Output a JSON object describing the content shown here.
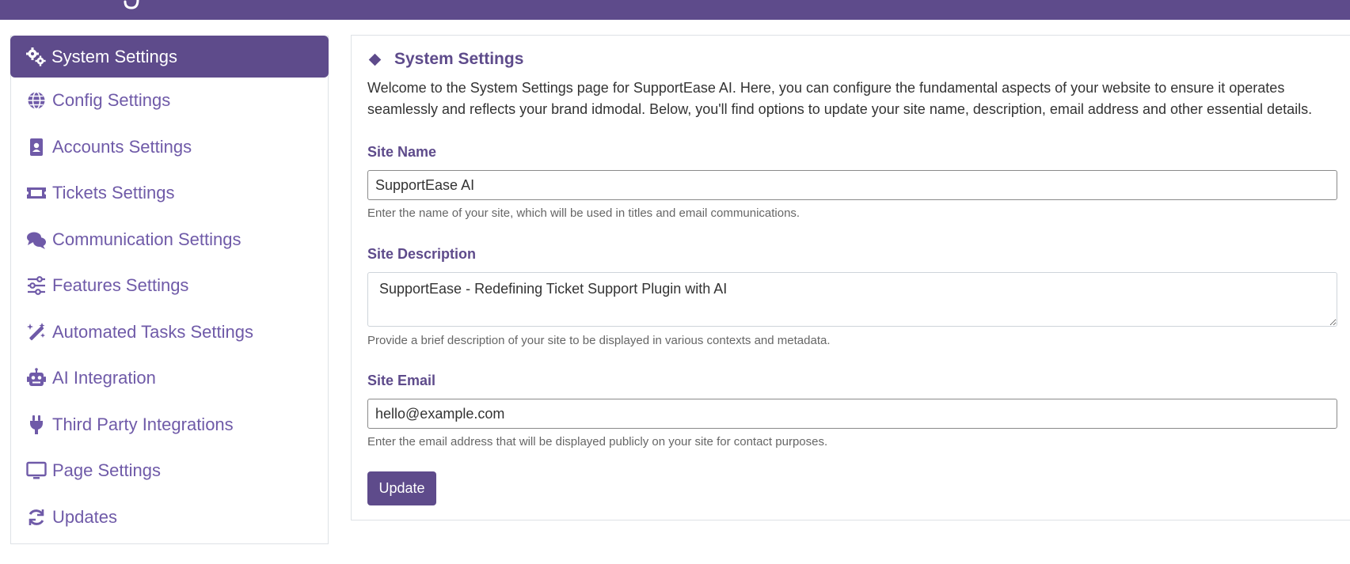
{
  "colors": {
    "brand": "#5e4b8b",
    "link": "#6f5aa8"
  },
  "sidebar": {
    "items": [
      {
        "label": "System Settings",
        "icon": "gears-icon",
        "active": true
      },
      {
        "label": "Config Settings",
        "icon": "globe-icon"
      },
      {
        "label": "Accounts Settings",
        "icon": "id-badge-icon"
      },
      {
        "label": "Tickets Settings",
        "icon": "ticket-icon"
      },
      {
        "label": "Communication Settings",
        "icon": "comments-icon"
      },
      {
        "label": "Features Settings",
        "icon": "sliders-icon"
      },
      {
        "label": "Automated Tasks Settings",
        "icon": "magic-wand-icon"
      },
      {
        "label": "AI Integration",
        "icon": "robot-icon"
      },
      {
        "label": "Third Party Integrations",
        "icon": "plug-icon"
      },
      {
        "label": "Page Settings",
        "icon": "desktop-icon"
      },
      {
        "label": "Updates",
        "icon": "refresh-icon"
      }
    ]
  },
  "main": {
    "title": "System Settings",
    "intro": "Welcome to the System Settings page for SupportEase AI. Here, you can configure the fundamental aspects of your website to ensure it operates seamlessly and reflects your brand idmodal. Below, you'll find options to update your site name, description, email address and other essential details.",
    "site_name": {
      "label": "Site Name",
      "value": "SupportEase AI",
      "help": "Enter the name of your site, which will be used in titles and email communications."
    },
    "site_description": {
      "label": "Site Description",
      "value": "SupportEase - Redefining Ticket Support Plugin with AI",
      "help": "Provide a brief description of your site to be displayed in various contexts and metadata."
    },
    "site_email": {
      "label": "Site Email",
      "value": "hello@example.com",
      "help": "Enter the email address that will be displayed publicly on your site for contact purposes."
    },
    "update_label": "Update"
  }
}
